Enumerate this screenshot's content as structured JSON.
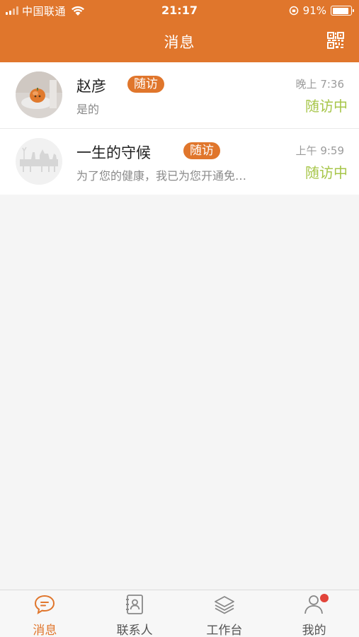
{
  "status_bar": {
    "carrier": "中国联通",
    "time": "21:17",
    "battery": "91%",
    "battery_level": 0.91
  },
  "nav": {
    "title": "消息",
    "qr_icon": "qr-code-icon"
  },
  "messages": [
    {
      "name": "赵彦",
      "tag": "随访",
      "preview": "是的",
      "time": "晚上 7:36",
      "status": "随访中",
      "avatar": "orange-fruit-avatar"
    },
    {
      "name": "一生的守候",
      "tag": "随访",
      "preview": "为了您的健康，我已为您开通免…",
      "time": "上午 9:59",
      "status": "随访中",
      "avatar": "deer-silhouette-avatar"
    }
  ],
  "tabs": [
    {
      "label": "消息",
      "icon": "chat-bubble-icon",
      "active": true
    },
    {
      "label": "联系人",
      "icon": "contacts-book-icon",
      "active": false
    },
    {
      "label": "工作台",
      "icon": "layers-icon",
      "active": false
    },
    {
      "label": "我的",
      "icon": "user-icon",
      "active": false,
      "badge": true
    }
  ],
  "colors": {
    "brand": "#e0762c",
    "status_green": "#a7c64a",
    "badge_red": "#e2443a"
  }
}
